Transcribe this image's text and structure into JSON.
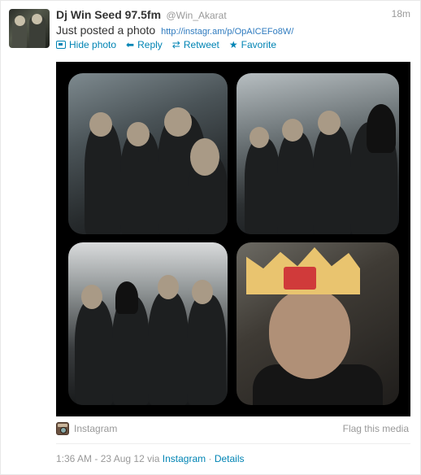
{
  "tweet": {
    "fullname": "Dj Win Seed 97.5fm",
    "screen_name": "@Win_Akarat",
    "time": "18m",
    "text": "Just posted a photo",
    "link": "http://instagr.am/p/OpAICEFo8W/"
  },
  "actions": {
    "hide_photo": "Hide photo",
    "reply": "Reply",
    "retweet": "Retweet",
    "favorite": "Favorite"
  },
  "media": {
    "source_label": "Instagram",
    "flag_label": "Flag this media"
  },
  "meta": {
    "timestamp": "1:36 AM - 23 Aug 12 via",
    "via_app": "Instagram",
    "separator": "·",
    "details": "Details"
  },
  "icons": {
    "hide_photo": "photo-icon",
    "reply": "reply-arrow-icon",
    "retweet": "retweet-icon",
    "favorite": "star-icon",
    "instagram": "instagram-icon"
  },
  "colors": {
    "link": "#0084b4",
    "muted": "#999999",
    "text": "#333333"
  }
}
